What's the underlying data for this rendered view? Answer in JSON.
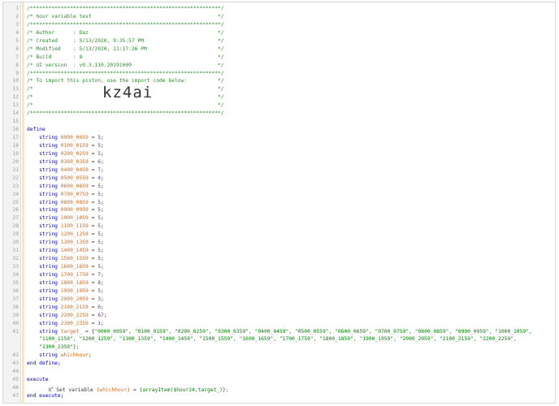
{
  "import_code": "kz4ai",
  "lines": [
    {
      "n": "1",
      "c": "/**************************************************************/"
    },
    {
      "n": "2",
      "c": "/* hour variable test                                         */"
    },
    {
      "n": "3",
      "c": "/**************************************************************/"
    },
    {
      "n": "4",
      "c": "/* Author      : Daz                                          */"
    },
    {
      "n": "5",
      "c": "/* Created     : 5/13/2020, 9:35:57 PM                        */"
    },
    {
      "n": "6",
      "c": "/* Modified    : 5/13/2020, 11:17:26 PM                       */"
    },
    {
      "n": "7",
      "c": "/* Build       : 8                                            */"
    },
    {
      "n": "8",
      "c": "/* UI version  : v0.3.110.20191009                            */"
    },
    {
      "n": "9",
      "c": "/**************************************************************/"
    },
    {
      "n": "10",
      "c": "/* To import this piston, use the import code below:          */"
    },
    {
      "n": "11",
      "c": "/*                                                            */"
    },
    {
      "n": "12",
      "c": "/*                                                            */"
    },
    {
      "n": "13",
      "c": "/*                                                            */"
    },
    {
      "n": "14",
      "c": "/**************************************************************/"
    },
    {
      "n": "15",
      "c": ""
    },
    {
      "n": "16",
      "c": "define"
    },
    {
      "n": "17",
      "v": "0000_0059",
      "val": "5"
    },
    {
      "n": "18",
      "v": "0100_0159",
      "val": "5"
    },
    {
      "n": "19",
      "v": "0200_0259",
      "val": "5"
    },
    {
      "n": "20",
      "v": "0300_0359",
      "val": "6"
    },
    {
      "n": "21",
      "v": "0400_0459",
      "val": "7"
    },
    {
      "n": "22",
      "v": "0500_0559",
      "val": "4"
    },
    {
      "n": "23",
      "v": "0600_0659",
      "val": "5"
    },
    {
      "n": "24",
      "v": "0700_0759",
      "val": "5"
    },
    {
      "n": "25",
      "v": "0800_0859",
      "val": "5"
    },
    {
      "n": "26",
      "v": "0900_0959",
      "val": "5"
    },
    {
      "n": "27",
      "v": "1000_1059",
      "val": "5"
    },
    {
      "n": "28",
      "v": "1100_1159",
      "val": "5"
    },
    {
      "n": "29",
      "v": "1200_1259",
      "val": "5"
    },
    {
      "n": "30",
      "v": "1300_1359",
      "val": "5"
    },
    {
      "n": "31",
      "v": "1400_1459",
      "val": "5"
    },
    {
      "n": "32",
      "v": "1500_1559",
      "val": "5"
    },
    {
      "n": "33",
      "v": "1600_1659",
      "val": "5"
    },
    {
      "n": "34",
      "v": "1700_1759",
      "val": "7"
    },
    {
      "n": "35",
      "v": "1800_1859",
      "val": "8"
    },
    {
      "n": "36",
      "v": "1900_1959",
      "val": "5"
    },
    {
      "n": "37",
      "v": "2000_2059",
      "val": "3"
    },
    {
      "n": "38",
      "v": "2100_2159",
      "val": "6"
    },
    {
      "n": "39",
      "v": "2200_2259",
      "val": "67"
    },
    {
      "n": "40",
      "v": "2300_2359",
      "val": "1"
    }
  ],
  "target_line": {
    "n": "41",
    "var": "target_",
    "items_row1": "\"0000_0059\", \"0100_0159\", \"0200_0259\", \"0300_0359\", \"0400_0459\", \"0500_0559\", \"0600_0659\", \"0700_0759\", \"0800_0859\", \"0900_0959\", \"1000_1059\",",
    "items_row2": "\"1100_1159\", \"1200_1259\", \"1300_1359\", \"1400_1459\", \"1500_1559\", \"1600_1659\", \"1700_1759\", \"1800_1859\", \"1900_1959\", \"2000_2059\", \"2100_2159\", \"2200_2259\",",
    "items_row3": "\"2300_2359\"};"
  },
  "whichhour_line": {
    "n": "42",
    "var": "whichhour"
  },
  "end_define": {
    "n": "43",
    "text": "end define;"
  },
  "blank44": {
    "n": "44"
  },
  "execute": {
    "n": "45",
    "text": "execute"
  },
  "set_line": {
    "n": "46",
    "icon": "xs-icon",
    "prefix": "Set variable ",
    "var": "{whichhour}",
    "rest": " = ",
    "expr": "{arrayItem($hour24,target_)};"
  },
  "end_execute": {
    "n": "47",
    "text": "end execute;"
  },
  "keyword_string": "string",
  "colors": {
    "comment": "#2e8b2e",
    "keyword": "#0000c8",
    "variable": "#d2691e",
    "string": "#008000",
    "number": "#6b2fa0"
  }
}
